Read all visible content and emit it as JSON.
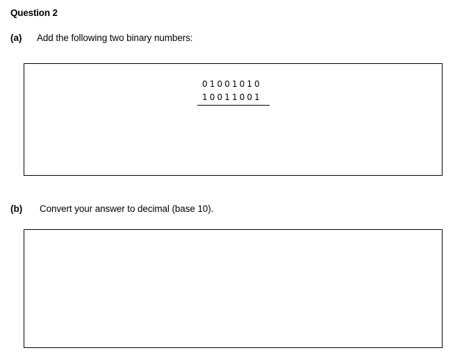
{
  "question": {
    "title": "Question 2"
  },
  "part_a": {
    "label": "(a)",
    "prompt": "Add the following two binary numbers:",
    "operand_1": "01001010",
    "operand_2": "10011001"
  },
  "part_b": {
    "label": "(b)",
    "prompt": "Convert your answer to decimal (base 10)."
  }
}
